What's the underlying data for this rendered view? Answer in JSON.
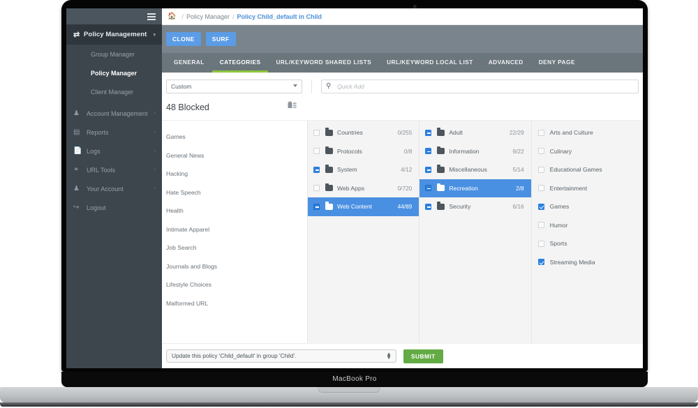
{
  "device": {
    "brand_label": "MacBook Pro"
  },
  "sidebar": {
    "menu_icon": "hamburger-icon",
    "section": {
      "icon": "shuffle-icon",
      "label": "Policy Management",
      "caret": "⌄"
    },
    "sub_items": [
      {
        "label": "Group Manager",
        "active": false
      },
      {
        "label": "Policy Manager",
        "active": true
      },
      {
        "label": "Client Manager",
        "active": false
      }
    ],
    "items": [
      {
        "icon": "users-icon",
        "glyph": "⛭",
        "label": "Account Management",
        "caret": "›"
      },
      {
        "icon": "chart-icon",
        "glyph": "☰",
        "label": "Reports",
        "caret": "›"
      },
      {
        "icon": "document-icon",
        "glyph": "☰",
        "label": "Logs",
        "caret": "›"
      },
      {
        "icon": "link-icon",
        "glyph": "◔",
        "label": "URL Tools",
        "caret": "›"
      },
      {
        "icon": "person-icon",
        "glyph": "♟",
        "label": "Your Account",
        "caret": "›"
      },
      {
        "icon": "logout-icon",
        "glyph": "↪",
        "label": "Logout",
        "caret": ""
      }
    ]
  },
  "breadcrumb": {
    "home_icon": "home-icon",
    "sep": "/",
    "parent": "Policy Manager",
    "current": "Policy Child_default in Child"
  },
  "actions": {
    "clone_label": "CLONE",
    "surf_label": "SURF"
  },
  "tabs": [
    {
      "label": "GENERAL",
      "active": false
    },
    {
      "label": "CATEGORIES",
      "active": true
    },
    {
      "label": "URL/KEYWORD SHARED LISTS",
      "active": false
    },
    {
      "label": "URL/KEYWORD LOCAL LIST",
      "active": false
    },
    {
      "label": "ADVANCED",
      "active": false
    },
    {
      "label": "DENY PAGE",
      "active": false
    }
  ],
  "filters": {
    "preset_selected": "Custom",
    "preset_options": [
      "Custom"
    ],
    "search_placeholder": "Quick Add",
    "search_value": "",
    "search_icon": "search-icon"
  },
  "blocked": {
    "count_label": "48 Blocked",
    "trash_icon": "trash-list-icon",
    "items": [
      "Games",
      "General News",
      "Hacking",
      "Hate Speech",
      "Health",
      "Intimate Apparel",
      "Job Search",
      "Journals and Blogs",
      "Lifestyle Choices",
      "Malformed URL"
    ]
  },
  "tree_level1": [
    {
      "label": "Countries",
      "count": "0/255",
      "state": "unchecked",
      "selected": false
    },
    {
      "label": "Protocols",
      "count": "0/8",
      "state": "unchecked",
      "selected": false
    },
    {
      "label": "System",
      "count": "4/12",
      "state": "partial",
      "selected": false
    },
    {
      "label": "Web Apps",
      "count": "0/720",
      "state": "unchecked",
      "selected": false
    },
    {
      "label": "Web Content",
      "count": "44/89",
      "state": "partial",
      "selected": true
    }
  ],
  "tree_level2": [
    {
      "label": "Adult",
      "count": "22/29",
      "state": "partial",
      "selected": false
    },
    {
      "label": "Information",
      "count": "9/22",
      "state": "partial",
      "selected": false
    },
    {
      "label": "Miscellaneous",
      "count": "5/14",
      "state": "partial",
      "selected": false
    },
    {
      "label": "Recreation",
      "count": "2/8",
      "state": "partial",
      "selected": true
    },
    {
      "label": "Security",
      "count": "6/16",
      "state": "partial",
      "selected": false
    }
  ],
  "tree_level3": [
    {
      "label": "Arts and Culture",
      "state": "unchecked"
    },
    {
      "label": "Culinary",
      "state": "unchecked"
    },
    {
      "label": "Educational Games",
      "state": "unchecked"
    },
    {
      "label": "Entertainment",
      "state": "unchecked"
    },
    {
      "label": "Games",
      "state": "checked"
    },
    {
      "label": "Humor",
      "state": "unchecked"
    },
    {
      "label": "Sports",
      "state": "unchecked"
    },
    {
      "label": "Streaming Media",
      "state": "checked"
    }
  ],
  "footer": {
    "action_selected": "Update this policy 'Child_default' in group 'Child'.",
    "action_options": [
      "Update this policy 'Child_default' in group 'Child'."
    ],
    "submit_label": "SUBMIT"
  },
  "colors": {
    "accent_blue": "#4a90e2",
    "tab_active": "#8dc63f",
    "submit_green": "#63ab45",
    "sidebar_bg": "#3d464d",
    "actionbar_bg": "#7a848c"
  }
}
